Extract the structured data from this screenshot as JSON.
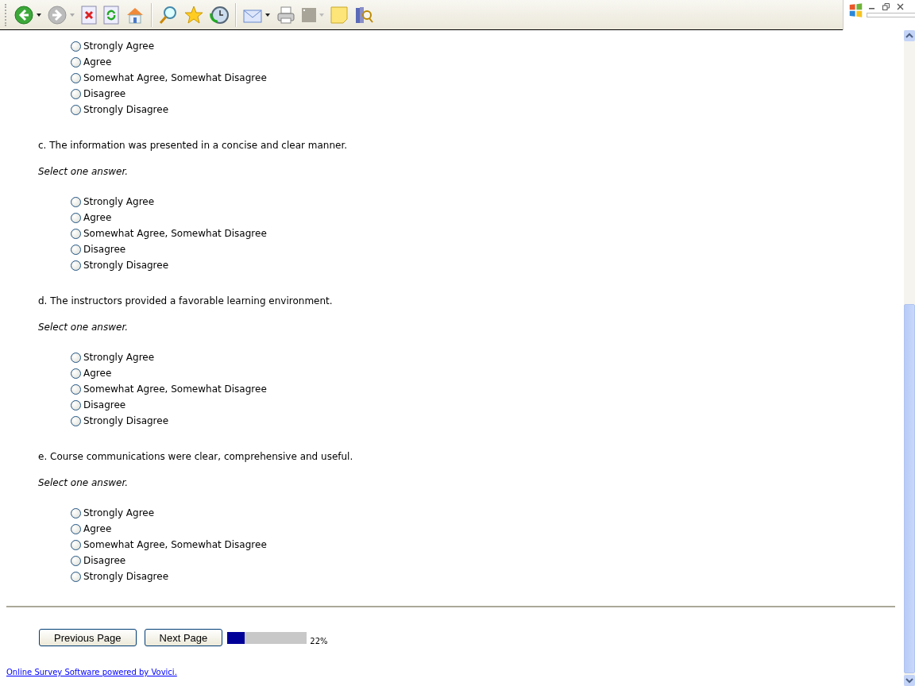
{
  "questions": [
    {
      "options": [
        {
          "label": "Strongly Agree",
          "selected": false
        },
        {
          "label": "Agree",
          "selected": false
        },
        {
          "label": "Somewhat Agree, Somewhat Disagree",
          "selected": false
        },
        {
          "label": "Disagree",
          "selected": false
        },
        {
          "label": "Strongly Disagree",
          "selected": false
        }
      ]
    },
    {
      "text": "c. The information was presented in a concise and clear manner.",
      "instruction": "Select one answer.",
      "options": [
        {
          "label": "Strongly Agree",
          "selected": false
        },
        {
          "label": "Agree",
          "selected": false
        },
        {
          "label": "Somewhat Agree, Somewhat Disagree",
          "selected": false
        },
        {
          "label": "Disagree",
          "selected": false
        },
        {
          "label": "Strongly Disagree",
          "selected": false
        }
      ]
    },
    {
      "text": "d. The instructors provided a favorable learning environment.",
      "instruction": "Select one answer.",
      "options": [
        {
          "label": "Strongly Agree",
          "selected": false
        },
        {
          "label": "Agree",
          "selected": false
        },
        {
          "label": "Somewhat Agree, Somewhat Disagree",
          "selected": false
        },
        {
          "label": "Disagree",
          "selected": false
        },
        {
          "label": "Strongly Disagree",
          "selected": false
        }
      ]
    },
    {
      "text": "e. Course communications were clear, comprehensive and useful.",
      "instruction": "Select one answer.",
      "options": [
        {
          "label": "Strongly Agree",
          "selected": false
        },
        {
          "label": "Agree",
          "selected": false
        },
        {
          "label": "Somewhat Agree, Somewhat Disagree",
          "selected": false
        },
        {
          "label": "Disagree",
          "selected": false
        },
        {
          "label": "Strongly Disagree",
          "selected": false
        }
      ]
    }
  ],
  "buttons": [
    "Previous Page",
    "Next Page"
  ],
  "progress": {
    "level": 0.22,
    "reading": "22%"
  },
  "footer_link": "Online Survey Software powered by Vovici."
}
